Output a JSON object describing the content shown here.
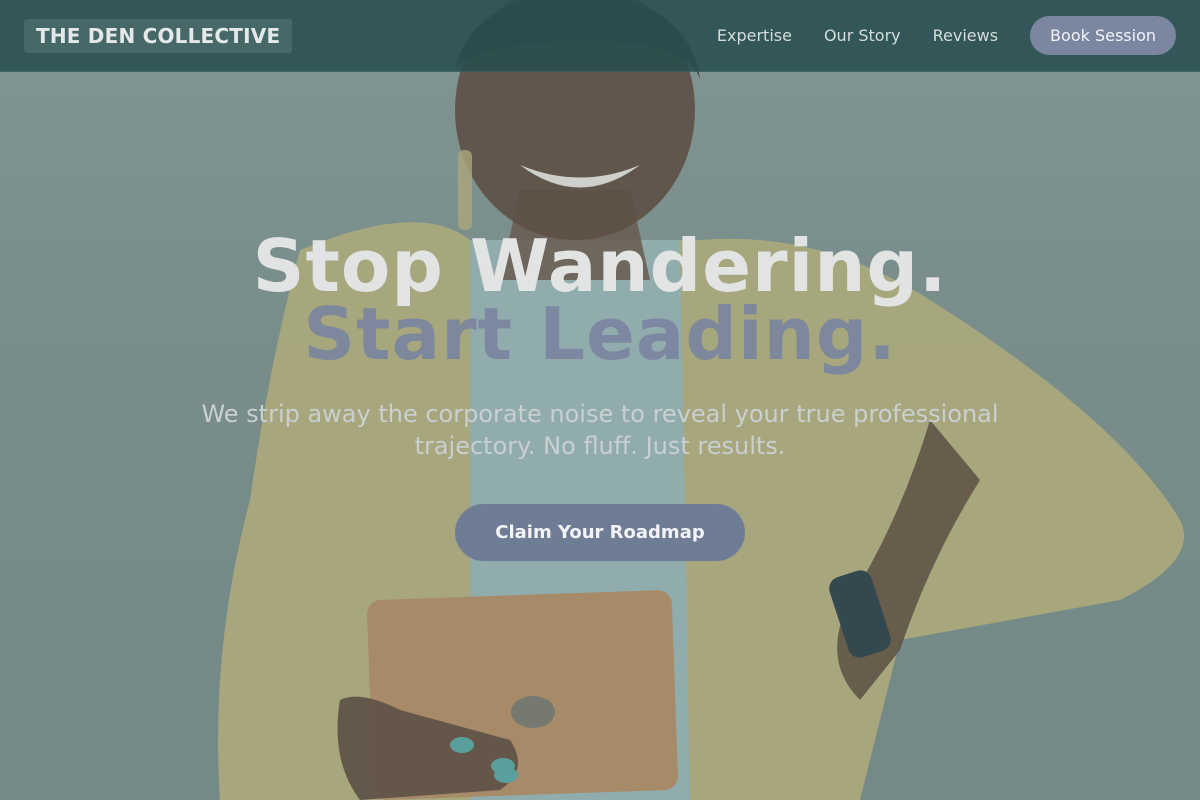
{
  "brand": {
    "logo": "THE DEN COLLECTIVE"
  },
  "nav": {
    "links": [
      "Expertise",
      "Our Story",
      "Reviews"
    ],
    "cta_label": "Book Session"
  },
  "hero": {
    "headline_line1": "Stop Wandering.",
    "headline_line2": "Start Leading.",
    "subtext": "We strip away the corporate noise to reveal your true professional trajectory. No fluff. Just results.",
    "cta_label": "Claim Your Roadmap"
  },
  "colors": {
    "nav_bg": "#284e50",
    "accent": "#7b87a1",
    "headline": "#e2e3e3",
    "headline_accent": "#7a85a0"
  }
}
